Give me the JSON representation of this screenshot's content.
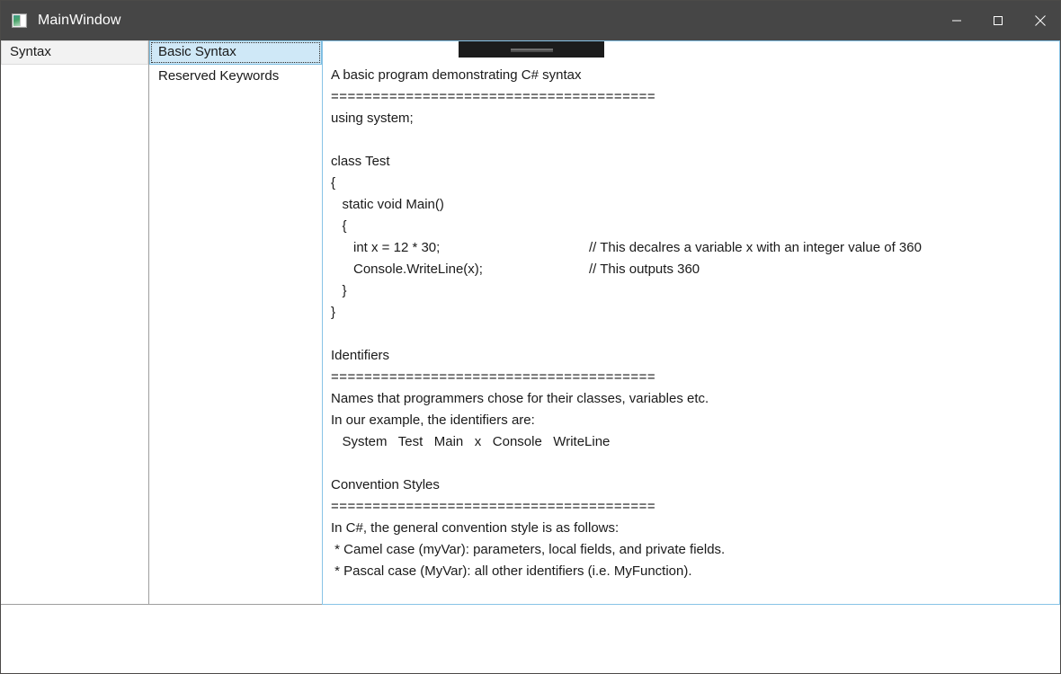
{
  "window": {
    "title": "MainWindow",
    "icon": "app-window-icon",
    "controls": {
      "minimize": "minimize-icon",
      "maximize": "maximize-icon",
      "close": "close-icon"
    },
    "colors": {
      "titlebar_bg": "#464646",
      "titlebar_fg": "#ffffff",
      "panel_border": "#9e9e9e",
      "focus_border": "#88c3e6",
      "selection_bg": "#cfe8f7",
      "selection_border": "#7cbde0",
      "hover_bg": "#f2f2f2",
      "handle_bg": "#1c1c1c"
    }
  },
  "columns": {
    "categories": {
      "items": [
        {
          "label": "Syntax",
          "state": "hover"
        }
      ]
    },
    "topics": {
      "items": [
        {
          "label": "Basic Syntax",
          "state": "selected"
        },
        {
          "label": "Reserved Keywords",
          "state": "normal"
        }
      ]
    }
  },
  "content": {
    "lines": [
      {
        "text": "A basic program demonstrating C# syntax"
      },
      {
        "text": "=======================================",
        "rule": true
      },
      {
        "text": "using system;"
      },
      {
        "text": ""
      },
      {
        "text": "class Test"
      },
      {
        "text": "{"
      },
      {
        "text": "   static void Main()"
      },
      {
        "text": "   {"
      },
      {
        "code": "      int x = 12 * 30;",
        "comment": "// This decalres a variable x with an integer value of 360"
      },
      {
        "code": "      Console.WriteLine(x);",
        "comment": "// This outputs 360"
      },
      {
        "text": "   }"
      },
      {
        "text": "}"
      },
      {
        "text": ""
      },
      {
        "text": "Identifiers"
      },
      {
        "text": "=======================================",
        "rule": true
      },
      {
        "text": "Names that programmers chose for their classes, variables etc."
      },
      {
        "text": "In our example, the identifiers are:"
      },
      {
        "text": "   System   Test   Main   x   Console   WriteLine"
      },
      {
        "text": ""
      },
      {
        "text": "Convention Styles"
      },
      {
        "text": "=======================================",
        "rule": true
      },
      {
        "text": "In C#, the general convention style is as follows:"
      },
      {
        "text": " * Camel case (myVar): parameters, local fields, and private fields."
      },
      {
        "text": " * Pascal case (MyVar): all other identifiers (i.e. MyFunction)."
      }
    ],
    "overlay_handle": "drag-grip-handle"
  }
}
